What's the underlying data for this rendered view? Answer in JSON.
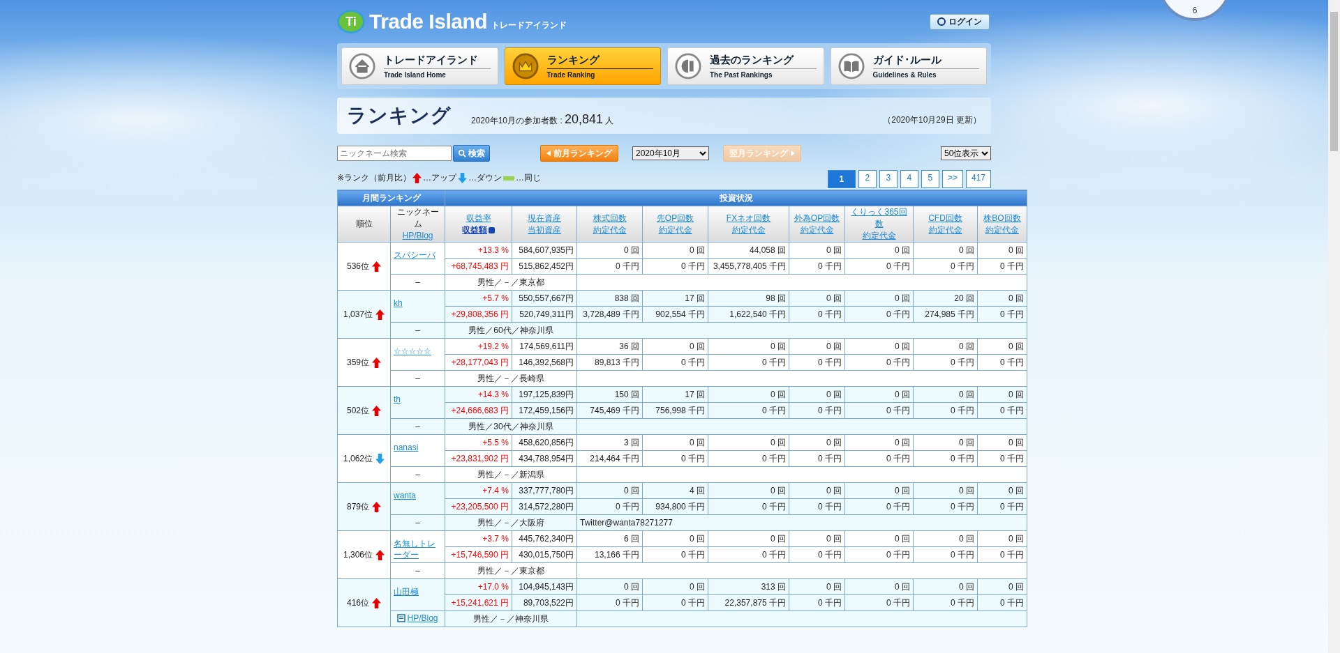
{
  "clock": {
    "numeral": "6"
  },
  "logo": {
    "mark": "Ti",
    "name": "Trade Island",
    "kana": "トレードアイランド"
  },
  "login": {
    "label": "ログイン"
  },
  "nav": [
    {
      "title": "トレードアイランド",
      "subtitle": "Trade Island Home",
      "kind": "home",
      "selected": false
    },
    {
      "title": "ランキング",
      "subtitle": "Trade Ranking",
      "kind": "crown",
      "selected": true
    },
    {
      "title": "過去のランキング",
      "subtitle": "The Past Rankings",
      "kind": "history",
      "selected": false
    },
    {
      "title": "ガイド･ルール",
      "subtitle": "Guidelines & Rules",
      "kind": "book",
      "selected": false
    }
  ],
  "banner": {
    "title": "ランキング",
    "participants_label": "2020年10月の参加者数 : ",
    "participants": "20,841",
    "participants_unit": "人",
    "updated": "（2020年10月29日 更新）"
  },
  "controls": {
    "search": {
      "placeholder": "ニックネーム検索",
      "button": "検索"
    },
    "prev": {
      "label": "前月ランキング",
      "disabled": false
    },
    "month": "2020年10月",
    "next": {
      "label": "翌月ランキング",
      "disabled": true
    },
    "per_page": "50位表示"
  },
  "legend": {
    "note": "※ランク（前月比）",
    "items": [
      {
        "kind": "up",
        "label": "…アップ"
      },
      {
        "kind": "down",
        "label": "…ダウン"
      },
      {
        "kind": "same",
        "label": "…同じ"
      }
    ]
  },
  "pager": [
    {
      "label": "1",
      "selected": true
    },
    {
      "label": "2",
      "selected": false
    },
    {
      "label": "3",
      "selected": false
    },
    {
      "label": "4",
      "selected": false
    },
    {
      "label": "5",
      "selected": false
    },
    {
      "label": ">>",
      "selected": false
    },
    {
      "label": "417",
      "selected": false
    }
  ],
  "table": {
    "group_left": "月間ランキング",
    "group_right": "投資状況",
    "rank_header": "順位",
    "nick_header": "ニックネーム",
    "hp_header": "HP/Blog",
    "columns": [
      {
        "line1": "収益率",
        "line2": "収益額",
        "sorted": true
      },
      {
        "line1": "現在資産",
        "line2": "当初資産",
        "sorted": false
      },
      {
        "line1": "株式回数",
        "line2": "約定代金",
        "sorted": false
      },
      {
        "line1": "先OP回数",
        "line2": "約定代金",
        "sorted": false
      },
      {
        "line1": "FXネオ回数",
        "line2": "約定代金",
        "sorted": false
      },
      {
        "line1": "外為OP回数",
        "line2": "約定代金",
        "sorted": false
      },
      {
        "line1": "くりっく365回数",
        "line2": "約定代金",
        "sorted": false
      },
      {
        "line1": "CFD回数",
        "line2": "約定代金",
        "sorted": false
      },
      {
        "line1": "株BO回数",
        "line2": "約定代金",
        "sorted": false
      }
    ],
    "rows": [
      {
        "rank": "536位",
        "kind": "up",
        "nickname": "スパシーバ",
        "rate": "+13.3 %",
        "assets": "584,607,935円",
        "profit": "+68,745,483 円",
        "initial": "515,862,452円",
        "counts": [
          "0 回",
          "0 回",
          "44,058 回",
          "0 回",
          "0 回",
          "0 回",
          "0 回"
        ],
        "amounts": [
          "0 千円",
          "0 千円",
          "3,455,778,405 千円",
          "0 千円",
          "0 千円",
          "0 千円",
          "0 千円"
        ],
        "hp": {
          "kind": "none",
          "text": "–"
        },
        "profile": "男性／－／東京都"
      },
      {
        "rank": "1,037位",
        "kind": "up",
        "nickname": "kh",
        "rate": "+5.7 %",
        "assets": "550,557,667円",
        "profit": "+29,808,356 円",
        "initial": "520,749,311円",
        "counts": [
          "838 回",
          "17 回",
          "98 回",
          "0 回",
          "0 回",
          "20 回",
          "0 回"
        ],
        "amounts": [
          "3,728,489 千円",
          "902,554 千円",
          "1,622,540 千円",
          "0 千円",
          "0 千円",
          "274,985 千円",
          "0 千円"
        ],
        "hp": {
          "kind": "none",
          "text": "–"
        },
        "profile": "男性／60代／神奈川県"
      },
      {
        "rank": "359位",
        "kind": "up",
        "nickname": "☆☆☆☆☆",
        "rate": "+19.2 %",
        "assets": "174,569,611円",
        "profit": "+28,177,043 円",
        "initial": "146,392,568円",
        "counts": [
          "36 回",
          "0 回",
          "0 回",
          "0 回",
          "0 回",
          "0 回",
          "0 回"
        ],
        "amounts": [
          "89,813 千円",
          "0 千円",
          "0 千円",
          "0 千円",
          "0 千円",
          "0 千円",
          "0 千円"
        ],
        "hp": {
          "kind": "none",
          "text": "–"
        },
        "profile": "男性／－／長崎県"
      },
      {
        "rank": "502位",
        "kind": "up",
        "nickname": "th",
        "rate": "+14.3 %",
        "assets": "197,125,839円",
        "profit": "+24,666,683 円",
        "initial": "172,459,156円",
        "counts": [
          "150 回",
          "17 回",
          "0 回",
          "0 回",
          "0 回",
          "0 回",
          "0 回"
        ],
        "amounts": [
          "745,469 千円",
          "756,998 千円",
          "0 千円",
          "0 千円",
          "0 千円",
          "0 千円",
          "0 千円"
        ],
        "hp": {
          "kind": "none",
          "text": "–"
        },
        "profile": "男性／30代／神奈川県"
      },
      {
        "rank": "1,062位",
        "kind": "down",
        "nickname": "nanasi",
        "rate": "+5.5 %",
        "assets": "458,620,856円",
        "profit": "+23,831,902 円",
        "initial": "434,788,954円",
        "counts": [
          "3 回",
          "0 回",
          "0 回",
          "0 回",
          "0 回",
          "0 回",
          "0 回"
        ],
        "amounts": [
          "214,464 千円",
          "0 千円",
          "0 千円",
          "0 千円",
          "0 千円",
          "0 千円",
          "0 千円"
        ],
        "hp": {
          "kind": "none",
          "text": "–"
        },
        "profile": "男性／－／新潟県"
      },
      {
        "rank": "879位",
        "kind": "up",
        "nickname": "wanta",
        "rate": "+7.4 %",
        "assets": "337,777,780円",
        "profit": "+23,205,500 円",
        "initial": "314,572,280円",
        "counts": [
          "0 回",
          "4 回",
          "0 回",
          "0 回",
          "0 回",
          "0 回",
          "0 回"
        ],
        "amounts": [
          "0 千円",
          "934,800 千円",
          "0 千円",
          "0 千円",
          "0 千円",
          "0 千円",
          "0 千円"
        ],
        "hp": {
          "kind": "none",
          "text": "–"
        },
        "profile": "男性／－／大阪府",
        "memo": "Twitter@wanta78271277"
      },
      {
        "rank": "1,306位",
        "kind": "up",
        "nickname": "名無しトレーダー",
        "rate": "+3.7 %",
        "assets": "445,762,340円",
        "profit": "+15,746,590 円",
        "initial": "430,015,750円",
        "counts": [
          "6 回",
          "0 回",
          "0 回",
          "0 回",
          "0 回",
          "0 回",
          "0 回"
        ],
        "amounts": [
          "13,166 千円",
          "0 千円",
          "0 千円",
          "0 千円",
          "0 千円",
          "0 千円",
          "0 千円"
        ],
        "hp": {
          "kind": "none",
          "text": "–"
        },
        "profile": "男性／－／東京都"
      },
      {
        "rank": "416位",
        "kind": "up",
        "nickname": "山田極",
        "rate": "+17.0 %",
        "assets": "104,945,143円",
        "profit": "+15,241,621 円",
        "initial": "89,703,522円",
        "counts": [
          "0 回",
          "0 回",
          "313 回",
          "0 回",
          "0 回",
          "0 回",
          "0 回"
        ],
        "amounts": [
          "0 千円",
          "0 千円",
          "22,357,875 千円",
          "0 千円",
          "0 千円",
          "0 千円",
          "0 千円"
        ],
        "hp": {
          "kind": "link",
          "text": "HP/Blog"
        },
        "profile": "男性／－／神奈川県"
      }
    ]
  }
}
